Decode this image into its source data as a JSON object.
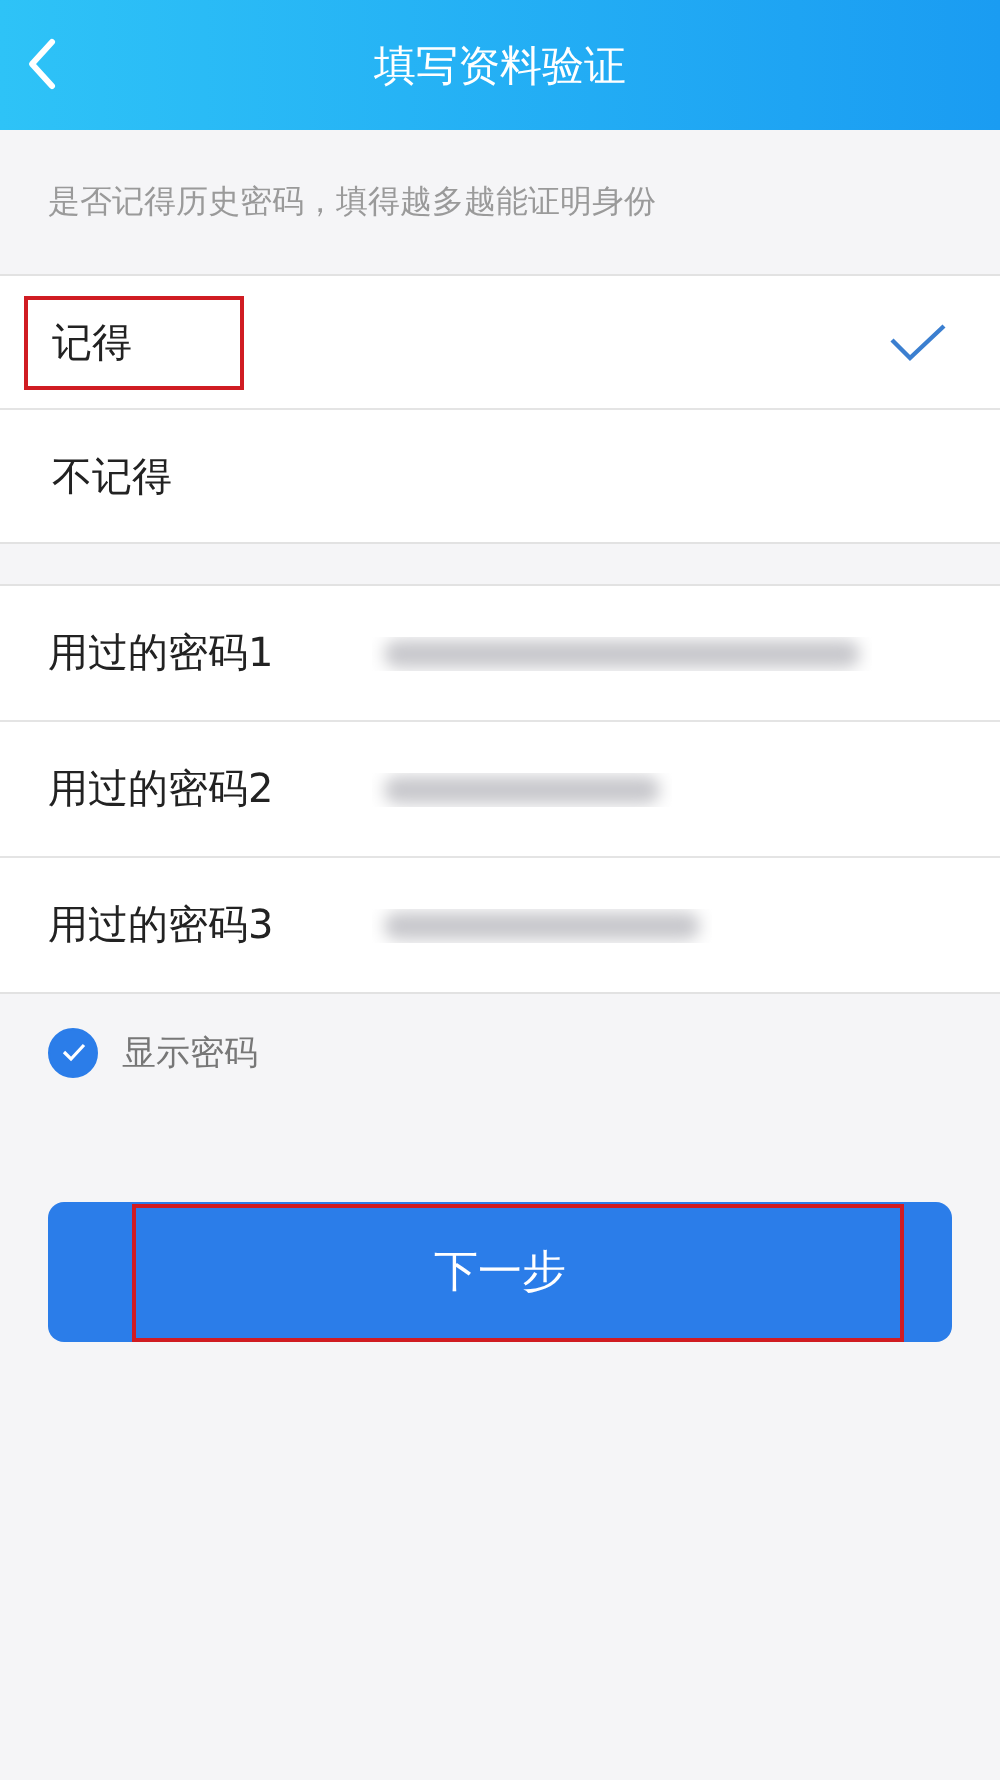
{
  "header": {
    "title": "填写资料验证"
  },
  "hint": "是否记得历史密码，填得越多越能证明身份",
  "options": [
    {
      "label": "记得",
      "selected": true,
      "highlighted": true
    },
    {
      "label": "不记得",
      "selected": false,
      "highlighted": false
    }
  ],
  "passwords": [
    {
      "label": "用过的密码1",
      "blurred": true
    },
    {
      "label": "用过的密码2",
      "blurred": true
    },
    {
      "label": "用过的密码3",
      "blurred": true
    }
  ],
  "show_password": {
    "label": "显示密码",
    "checked": true
  },
  "next_button": {
    "label": "下一步",
    "highlighted": true
  }
}
